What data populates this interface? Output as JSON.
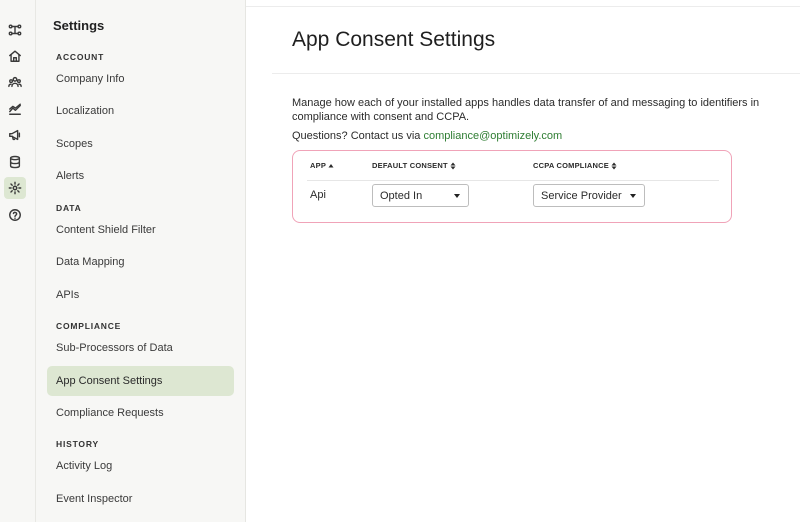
{
  "rail": {
    "icons": [
      "flow-icon",
      "home-icon",
      "users-icon",
      "analytics-icon",
      "megaphone-icon",
      "database-icon",
      "gear-icon",
      "help-icon"
    ]
  },
  "sidebar": {
    "title": "Settings",
    "sections": {
      "account": "ACCOUNT",
      "data": "DATA",
      "compliance": "COMPLIANCE",
      "history": "HISTORY"
    },
    "items": {
      "company_info": "Company Info",
      "localization": "Localization",
      "scopes": "Scopes",
      "alerts": "Alerts",
      "content_shield_filter": "Content Shield Filter",
      "data_mapping": "Data Mapping",
      "apis": "APIs",
      "sub_processors": "Sub-Processors of Data",
      "app_consent_settings": "App Consent Settings",
      "compliance_requests": "Compliance Requests",
      "activity_log": "Activity Log",
      "event_inspector": "Event Inspector"
    },
    "active_item": "App Consent Settings",
    "active_color": "#dde7d2"
  },
  "main": {
    "title": "App Consent Settings",
    "description": "Manage how each of your installed apps handles data transfer of and messaging to identifiers in compliance with consent and CCPA.",
    "questions_prefix": "Questions? Contact us via",
    "contact_email": "compliance@optimizely.com",
    "link_color": "#2e7d32",
    "table": {
      "border_color": "#f0a3b8",
      "headers": {
        "app": "APP",
        "default_consent": "DEFAULT CONSENT",
        "ccpa_compliance": "CCPA COMPLIANCE"
      },
      "rows": [
        {
          "app": "Api",
          "default_consent": "Opted In",
          "ccpa_compliance": "Service Provider"
        }
      ]
    }
  }
}
